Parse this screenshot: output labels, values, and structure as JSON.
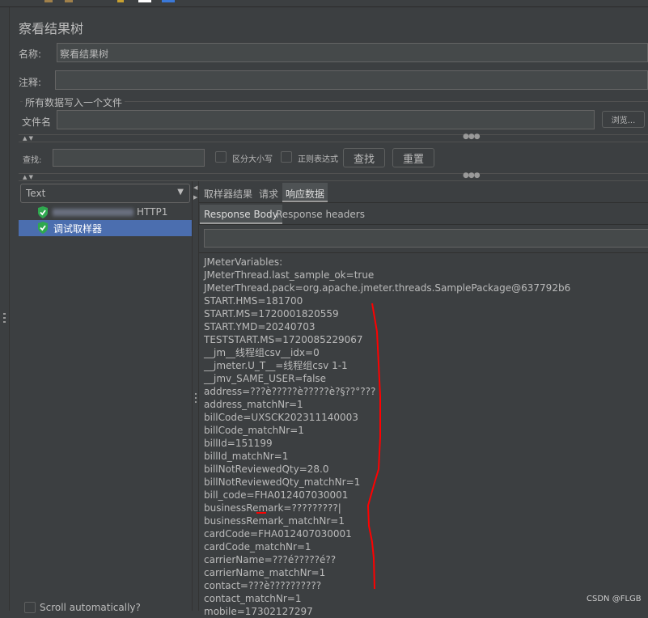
{
  "title": "察看结果树",
  "name_label": "名称:",
  "name_value": "察看结果树",
  "comment_label": "注释:",
  "comment_value": "",
  "file_group_label": "所有数据写入一个文件",
  "filename_label": "文件名",
  "filename_value": "",
  "browse_label": "浏览...",
  "search": {
    "label": "查找:",
    "value": "",
    "case_sensitive_label": "区分大小写",
    "case_sensitive_checked": false,
    "regex_label": "正则表达式",
    "regex_checked": false,
    "find_label": "查找",
    "reset_label": "重置"
  },
  "renderer_select": "Text",
  "tree": [
    {
      "label": "HTTP1",
      "status": "success",
      "selected": false
    },
    {
      "label": "调试取样器",
      "status": "success",
      "selected": true
    }
  ],
  "result_tabs": [
    "取样器结果",
    "请求",
    "响应数据"
  ],
  "active_result_tab": "响应数据",
  "body_tabs": [
    "Response Body",
    "Response headers"
  ],
  "active_body_tab": "Response Body",
  "response_search_value": "",
  "response_lines": [
    "JMeterVariables:",
    "JMeterThread.last_sample_ok=true",
    "JMeterThread.pack=org.apache.jmeter.threads.SamplePackage@637792b6",
    "START.HMS=181700",
    "START.MS=1720001820559",
    "START.YMD=20240703",
    "TESTSTART.MS=1720085229067",
    "__jm__线程组csv__idx=0",
    "__jmeter.U_T__=线程组csv 1-1",
    "__jmv_SAME_USER=false",
    "address=???è?????è?????è?§??°???",
    "address_matchNr=1",
    "billCode=UXSCK202311140003",
    "billCode_matchNr=1",
    "billId=151199",
    "billId_matchNr=1",
    "billNotReviewedQty=28.0",
    "billNotReviewedQty_matchNr=1",
    "bill_code=FHA012407030001",
    "businessRemark=?????????|",
    "businessRemark_matchNr=1",
    "cardCode=FHA012407030001",
    "cardCode_matchNr=1",
    "carrierName=???é?????é??",
    "carrierName_matchNr=1",
    "contact=???è??????????",
    "contact_matchNr=1",
    "mobile=17302127297"
  ],
  "scroll_auto_label": "Scroll automatically?",
  "scroll_auto_checked": false,
  "watermark": "CSDN @FLGB",
  "colors": {
    "selection": "#4b6eaf",
    "annotation": "#ff0000",
    "success": "#2fa84f"
  }
}
